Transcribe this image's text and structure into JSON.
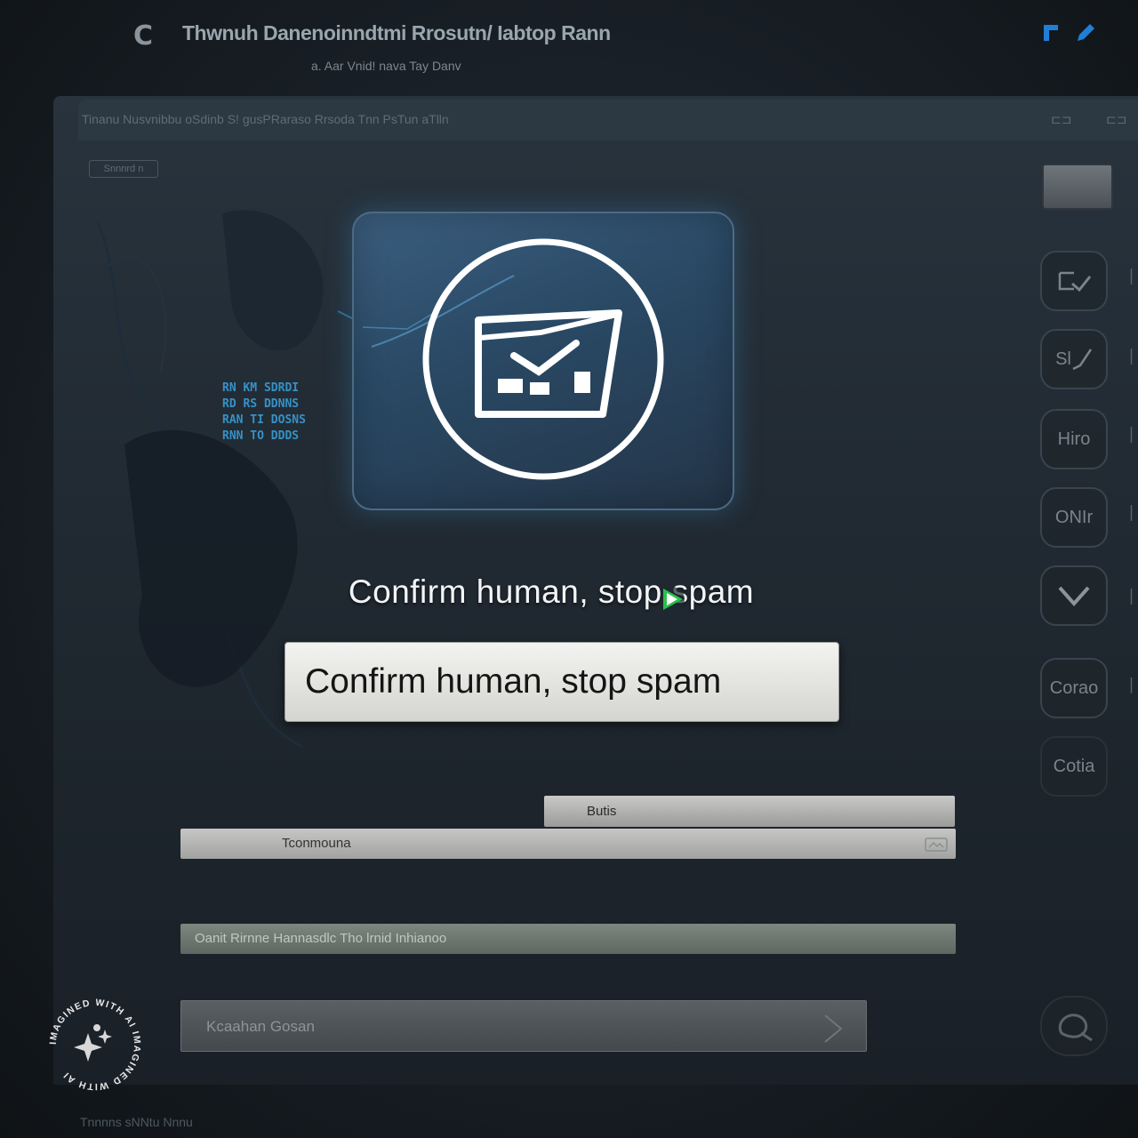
{
  "window": {
    "title": "Thwnuh Danenoinndtmi Rrosutn/ Iabtop Rann",
    "subtitle": "a. Aar Vnid! nava Tay Danv"
  },
  "panel": {
    "header_text": "Tinanu Nusvnibbu oSdinb S! gusPRaraso Rrsoda Tnn PsTun aTlln",
    "tag_label": "Snnnrd n"
  },
  "background_text": [
    "RN KM  SDRDI",
    "RD RS  DDNNS",
    "RAN TI DOSNS",
    "RNN TO DDDS"
  ],
  "hero": {
    "icon": "email-check-icon",
    "accent": "#3aa3e0"
  },
  "captcha": {
    "heading": "Confirm human, stop spam",
    "button_label": "Confirm human, stop spam"
  },
  "fields": {
    "field_a": "Butis",
    "field_b": "Tconmouna",
    "field_c": "Oanit Rirnne Hannasdlc Tho lrnid Inhianoo",
    "field_d": "Kcaahan Gosan"
  },
  "sidebar": {
    "items": [
      {
        "label": "",
        "icon": "window-thumbnail-icon"
      },
      {
        "label": "",
        "icon": "checkmark-circle-icon"
      },
      {
        "label": "Sl",
        "icon": "chart-icon"
      },
      {
        "label": "Hiro",
        "icon": "text-button-icon"
      },
      {
        "label": "ONIr",
        "icon": "text-button-icon"
      },
      {
        "label": "",
        "icon": "chevron-down-icon"
      },
      {
        "label": "Corao",
        "icon": "text-button-icon"
      },
      {
        "label": "Cotia",
        "icon": "text-button-icon"
      },
      {
        "label": "",
        "icon": "chat-icon"
      }
    ]
  },
  "badge": {
    "text": "IMAGINED WITH AI IMAGINED WITH AI",
    "icon": "sparkle-icon"
  },
  "footer": {
    "text": "Tnnnns sNNtu Nnnu"
  }
}
